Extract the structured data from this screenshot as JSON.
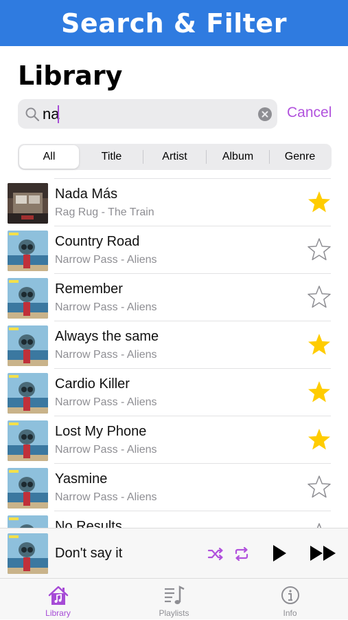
{
  "banner": {
    "title": "Search & Filter"
  },
  "page": {
    "title": "Library"
  },
  "search": {
    "value": "na",
    "cancel_label": "Cancel"
  },
  "filters": {
    "items": [
      "All",
      "Title",
      "Artist",
      "Album",
      "Genre"
    ],
    "selected": "All"
  },
  "songs": [
    {
      "title": "Nada Más",
      "subtitle": "Rag Rug - The Train",
      "favorite": true,
      "art": "album-art-rag-rug"
    },
    {
      "title": "Country Road",
      "subtitle": "Narrow Pass - Aliens",
      "favorite": false,
      "art": "album-art-aliens"
    },
    {
      "title": "Remember",
      "subtitle": "Narrow Pass - Aliens",
      "favorite": false,
      "art": "album-art-aliens"
    },
    {
      "title": "Always the same",
      "subtitle": "Narrow Pass - Aliens",
      "favorite": true,
      "art": "album-art-aliens"
    },
    {
      "title": "Cardio Killer",
      "subtitle": "Narrow Pass - Aliens",
      "favorite": true,
      "art": "album-art-aliens"
    },
    {
      "title": "Lost My Phone",
      "subtitle": "Narrow Pass - Aliens",
      "favorite": true,
      "art": "album-art-aliens"
    },
    {
      "title": "Yasmine",
      "subtitle": "Narrow Pass - Aliens",
      "favorite": false,
      "art": "album-art-aliens"
    },
    {
      "title": "No Results",
      "subtitle": "",
      "favorite": false,
      "art": "album-art-aliens"
    }
  ],
  "now_playing": {
    "title": "Don't say it",
    "art": "album-art-aliens",
    "controls": [
      "shuffle-icon",
      "repeat-icon",
      "play-icon",
      "fast-forward-icon"
    ]
  },
  "tabbar": {
    "items": [
      {
        "label": "Library",
        "icon": "house-music-icon",
        "active": true
      },
      {
        "label": "Playlists",
        "icon": "playlist-icon",
        "active": false
      },
      {
        "label": "Info",
        "icon": "info-icon",
        "active": false
      }
    ]
  },
  "colors": {
    "banner": "#2f7be0",
    "accent": "#b152dd",
    "star_filled": "#ffcc00",
    "star_outline": "#8e8e93"
  }
}
